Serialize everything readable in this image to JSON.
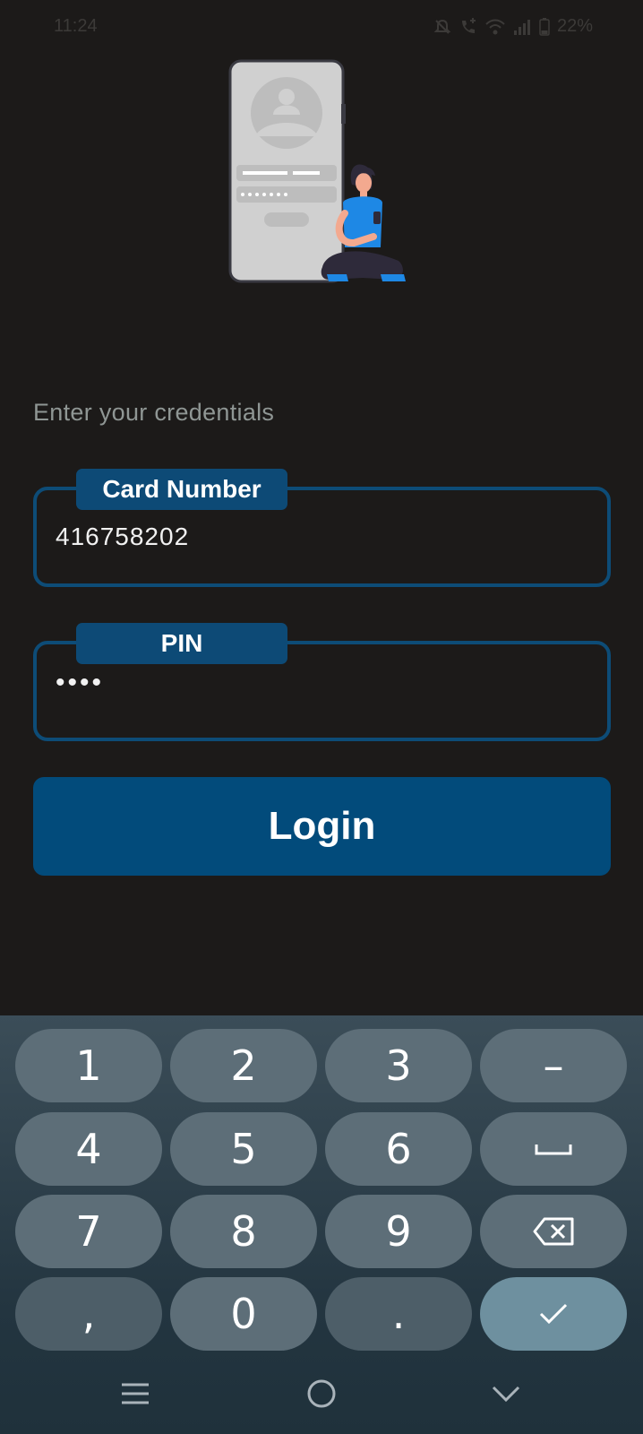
{
  "status_bar": {
    "time": "11:24",
    "battery": "22%",
    "icons": [
      "mute-icon",
      "call-icon",
      "wifi-icon",
      "signal-icon",
      "battery-icon"
    ]
  },
  "login": {
    "prompt": "Enter your credentials",
    "card_number_label": "Card Number",
    "card_number_value": "416758202",
    "pin_label": "PIN",
    "pin_value": "••••",
    "login_label": "Login"
  },
  "keyboard": {
    "keys": [
      "1",
      "2",
      "3",
      "–",
      "4",
      "5",
      "6",
      "␣",
      "7",
      "8",
      "9",
      "⌫",
      ",",
      "0",
      ".",
      "✓"
    ]
  },
  "nav_bar": {
    "icons": [
      "menu-icon",
      "home-icon",
      "back-icon"
    ]
  },
  "colors": {
    "background": "#1c1a19",
    "accent": "#024b7b",
    "field_border": "#0d4c77",
    "keyboard_bg": "#2a3c46",
    "key_bg": "#5d6e78",
    "confirm_key_bg": "#6e909f"
  }
}
